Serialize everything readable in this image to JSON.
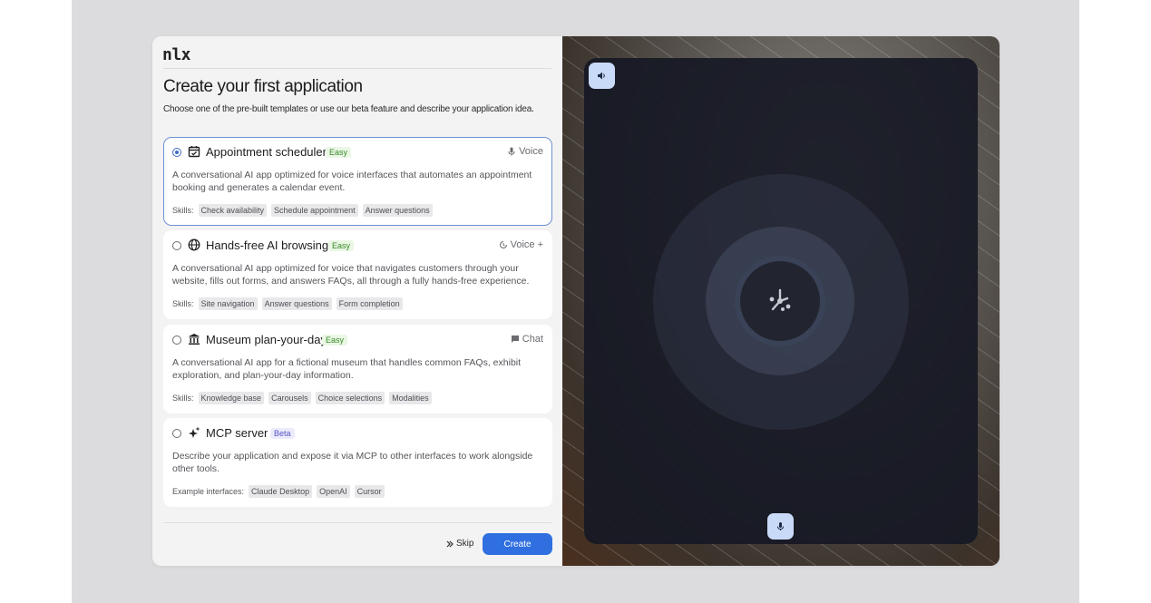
{
  "app": {
    "logo": "nlx"
  },
  "header": {
    "title": "Create your first application",
    "subtitle": "Choose one of the pre-built templates or use our beta feature and describe your application idea."
  },
  "templates": [
    {
      "name": "Appointment scheduler",
      "badge": "Easy",
      "mode": "Voice",
      "icon": "calendar-icon",
      "description": "A conversational AI app optimized for voice interfaces that automates an appointment booking and generates a calendar event.",
      "skills_label": "Skills:",
      "skills": [
        "Check availability",
        "Schedule appointment",
        "Answer questions"
      ],
      "selected": true
    },
    {
      "name": "Hands-free AI browsing",
      "badge": "Easy",
      "mode": "Voice +",
      "icon": "globe-icon",
      "description": "A conversational AI app optimized for voice that navigates customers through your website, fills out forms, and answers FAQs, all through a fully hands-free experience.",
      "skills_label": "Skills:",
      "skills": [
        "Site navigation",
        "Answer questions",
        "Form completion"
      ],
      "selected": false
    },
    {
      "name": "Museum plan-your-day",
      "badge": "Easy",
      "mode": "Chat",
      "icon": "museum-icon",
      "description": "A conversational AI app for a fictional museum that handles common FAQs, exhibit exploration, and plan-your-day information.",
      "skills_label": "Skills:",
      "skills": [
        "Knowledge base",
        "Carousels",
        "Choice selections",
        "Modalities"
      ],
      "selected": false
    },
    {
      "name": "MCP server",
      "badge": "Beta",
      "mode": "",
      "icon": "sparkle-icon",
      "description": "Describe your application and expose it via MCP to other interfaces to work alongside other tools.",
      "skills_label": "Example interfaces:",
      "skills": [
        "Claude Desktop",
        "OpenAI",
        "Cursor"
      ],
      "selected": false
    }
  ],
  "footer": {
    "skip_label": "Skip",
    "create_label": "Create"
  },
  "colors": {
    "accent": "#2f6fe0",
    "selected_border": "#6d91d4",
    "easy_badge": "#3a8a2a",
    "beta_badge": "#5754c8"
  }
}
